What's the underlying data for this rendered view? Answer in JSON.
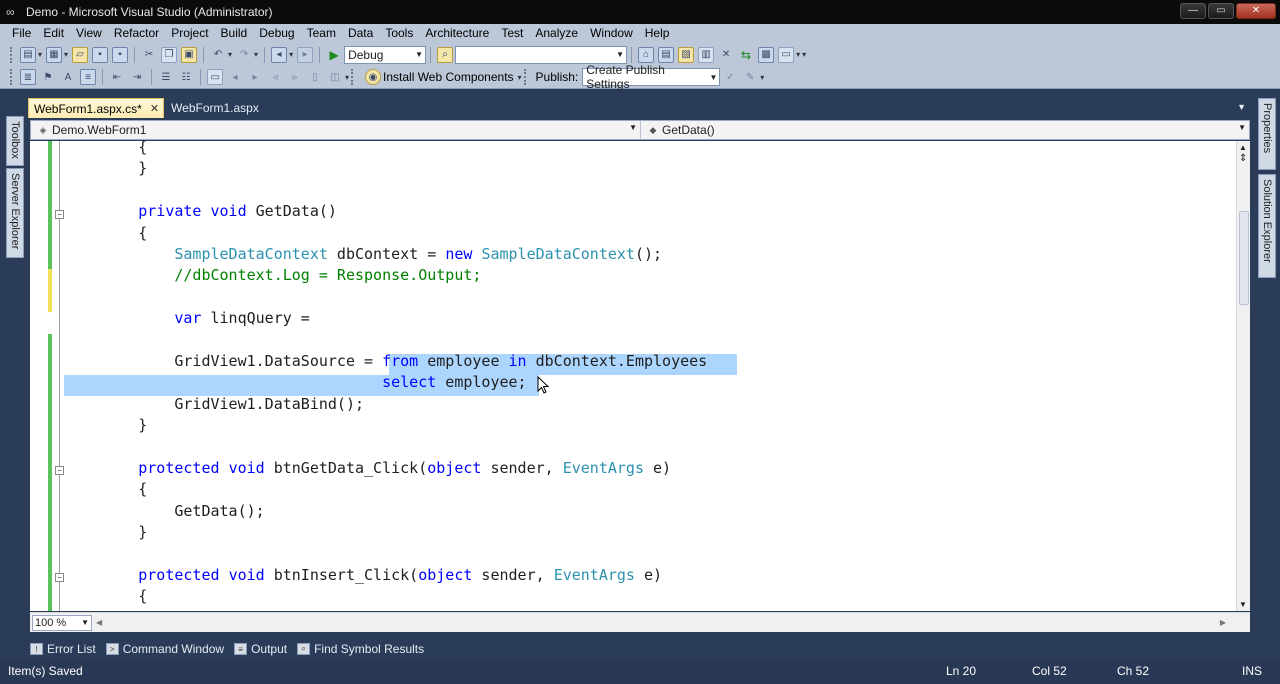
{
  "window": {
    "title": "Demo - Microsoft Visual Studio (Administrator)",
    "controls": [
      "minimize",
      "maximize",
      "close"
    ]
  },
  "menu": [
    "File",
    "Edit",
    "View",
    "Refactor",
    "Project",
    "Build",
    "Debug",
    "Team",
    "Data",
    "Tools",
    "Architecture",
    "Test",
    "Analyze",
    "Window",
    "Help"
  ],
  "toolbar1": {
    "config_value": "Debug",
    "find_value": ""
  },
  "toolbar2": {
    "install_label": "Install Web Components",
    "publish_label": "Publish:",
    "publish_value": "Create Publish Settings"
  },
  "side_tabs": {
    "left": [
      "Toolbox",
      "Server Explorer"
    ],
    "right": [
      "Properties",
      "Solution Explorer"
    ]
  },
  "tabs": [
    {
      "label": "WebForm1.aspx.cs*",
      "active": true
    },
    {
      "label": "WebForm1.aspx",
      "active": false
    }
  ],
  "nav": {
    "type_scope": "Demo.WebForm1",
    "member_scope": "GetData()"
  },
  "code_lines": [
    [
      {
        "t": "        {",
        "c": ""
      }
    ],
    [
      {
        "t": "        }",
        "c": ""
      }
    ],
    [
      {
        "t": "",
        "c": ""
      }
    ],
    [
      {
        "t": "        ",
        "c": ""
      },
      {
        "t": "private",
        "c": "kw"
      },
      {
        "t": " ",
        "c": ""
      },
      {
        "t": "void",
        "c": "kw"
      },
      {
        "t": " GetData()",
        "c": ""
      }
    ],
    [
      {
        "t": "        {",
        "c": ""
      }
    ],
    [
      {
        "t": "            ",
        "c": ""
      },
      {
        "t": "SampleDataContext",
        "c": "type"
      },
      {
        "t": " dbContext = ",
        "c": ""
      },
      {
        "t": "new",
        "c": "kw"
      },
      {
        "t": " ",
        "c": ""
      },
      {
        "t": "SampleDataContext",
        "c": "type"
      },
      {
        "t": "();",
        "c": ""
      }
    ],
    [
      {
        "t": "            ",
        "c": ""
      },
      {
        "t": "//dbContext.Log = Response.Output;",
        "c": "cm"
      }
    ],
    [
      {
        "t": "",
        "c": ""
      }
    ],
    [
      {
        "t": "            ",
        "c": ""
      },
      {
        "t": "var",
        "c": "kw"
      },
      {
        "t": " linqQuery =",
        "c": ""
      }
    ],
    [
      {
        "t": "",
        "c": ""
      }
    ],
    [
      {
        "t": "            GridView1.DataSource = ",
        "c": ""
      },
      {
        "t": "from",
        "c": "kw"
      },
      {
        "t": " employee ",
        "c": ""
      },
      {
        "t": "in",
        "c": "kw"
      },
      {
        "t": " dbContext.Employees",
        "c": ""
      }
    ],
    [
      {
        "t": "                                   ",
        "c": ""
      },
      {
        "t": "select",
        "c": "kw"
      },
      {
        "t": " employee;",
        "c": ""
      }
    ],
    [
      {
        "t": "            GridView1.DataBind();",
        "c": ""
      }
    ],
    [
      {
        "t": "        }",
        "c": ""
      }
    ],
    [
      {
        "t": "",
        "c": ""
      }
    ],
    [
      {
        "t": "        ",
        "c": ""
      },
      {
        "t": "protected",
        "c": "kw"
      },
      {
        "t": " ",
        "c": ""
      },
      {
        "t": "void",
        "c": "kw"
      },
      {
        "t": " btnGetData_Click(",
        "c": ""
      },
      {
        "t": "object",
        "c": "kw"
      },
      {
        "t": " sender, ",
        "c": ""
      },
      {
        "t": "EventArgs",
        "c": "type"
      },
      {
        "t": " e)",
        "c": ""
      }
    ],
    [
      {
        "t": "        {",
        "c": ""
      }
    ],
    [
      {
        "t": "            GetData();",
        "c": ""
      }
    ],
    [
      {
        "t": "        }",
        "c": ""
      }
    ],
    [
      {
        "t": "",
        "c": ""
      }
    ],
    [
      {
        "t": "        ",
        "c": ""
      },
      {
        "t": "protected",
        "c": "kw"
      },
      {
        "t": " ",
        "c": ""
      },
      {
        "t": "void",
        "c": "kw"
      },
      {
        "t": " btnInsert_Click(",
        "c": ""
      },
      {
        "t": "object",
        "c": "kw"
      },
      {
        "t": " sender, ",
        "c": ""
      },
      {
        "t": "EventArgs",
        "c": "type"
      },
      {
        "t": " e)",
        "c": ""
      }
    ],
    [
      {
        "t": "        {",
        "c": ""
      }
    ]
  ],
  "zoom": "100 %",
  "bottom_tabs": [
    "Error List",
    "Command Window",
    "Output",
    "Find Symbol Results"
  ],
  "status": {
    "message": "Item(s) Saved",
    "line": "Ln 20",
    "col": "Col 52",
    "ch": "Ch 52",
    "mode": "INS"
  },
  "colors": {
    "keyword": "#0000ff",
    "type": "#2b91af",
    "comment": "#008000",
    "selection": "#add6ff",
    "chrome": "#2b3c59"
  }
}
